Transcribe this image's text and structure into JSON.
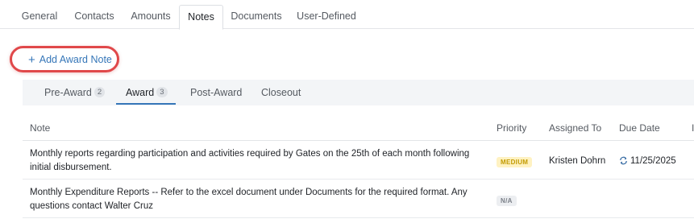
{
  "top_tabs": [
    {
      "label": "General"
    },
    {
      "label": "Contacts"
    },
    {
      "label": "Amounts"
    },
    {
      "label": "Notes",
      "active": true
    },
    {
      "label": "Documents"
    },
    {
      "label": "User-Defined"
    }
  ],
  "add_note": {
    "label": "Add Award Note",
    "icon": "plus-icon"
  },
  "sub_tabs": [
    {
      "label": "Pre-Award",
      "count": "2"
    },
    {
      "label": "Award",
      "count": "3",
      "active": true
    },
    {
      "label": "Post-Award"
    },
    {
      "label": "Closeout"
    }
  ],
  "table": {
    "headers": {
      "note": "Note",
      "priority": "Priority",
      "assigned": "Assigned To",
      "due": "Due Date",
      "extra": "I"
    },
    "rows": [
      {
        "note": "Monthly reports regarding participation and activities required by Gates on the 25th of each month following initial disbursement.",
        "priority": "MEDIUM",
        "assigned": "Kristen Dohrn",
        "due": "11/25/2025",
        "due_icon": "recurring-icon"
      },
      {
        "note": "Monthly Expenditure Reports -- Refer to the excel document under Documents for the required format. Any questions contact Walter Cruz",
        "priority": "N/A",
        "assigned": "",
        "due": ""
      }
    ]
  },
  "colors": {
    "accent": "#3576b8",
    "highlight": "#e0484a",
    "medium_bg": "#fff2c2",
    "medium_text": "#c29a00"
  }
}
